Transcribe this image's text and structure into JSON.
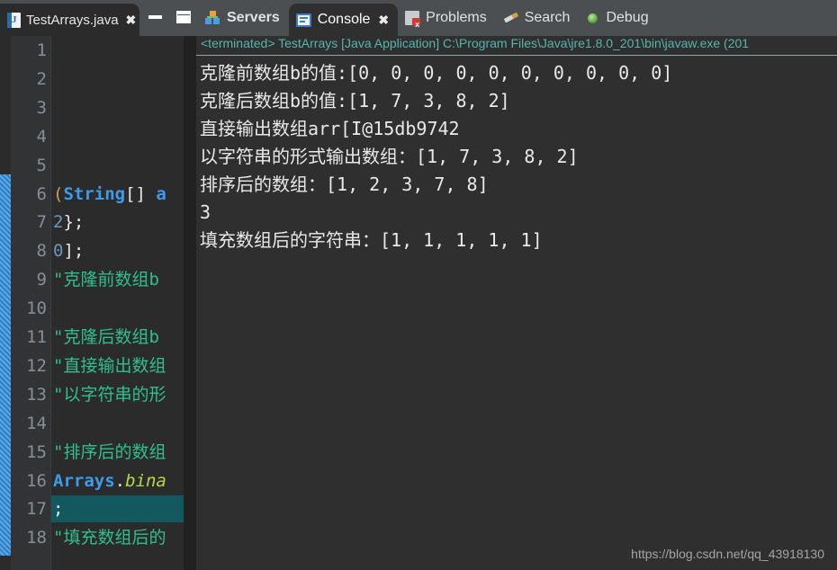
{
  "editor": {
    "tab": {
      "icon": "java-file-icon",
      "label": "TestArrays.java",
      "close": "✖"
    },
    "window_controls": {
      "minimize": "minimize",
      "maximize": "maximize"
    },
    "line_numbers": [
      "1",
      "2",
      "3",
      "4",
      "5",
      "6",
      "7",
      "8",
      "9",
      "10",
      "11",
      "12",
      "13",
      "14",
      "15",
      "16",
      "17",
      "18"
    ],
    "highlighted_line": "17",
    "code_lines": [
      {
        "line": "1",
        "segments": []
      },
      {
        "line": "2",
        "segments": []
      },
      {
        "line": "3",
        "segments": []
      },
      {
        "line": "4",
        "segments": []
      },
      {
        "line": "5",
        "segments": []
      },
      {
        "line": "6",
        "segments": [
          {
            "text": "(",
            "type": "paren"
          },
          {
            "text": "String",
            "type": "type"
          },
          {
            "text": "[]",
            "type": "punct"
          },
          {
            "text": " a",
            "type": "type"
          }
        ]
      },
      {
        "line": "7",
        "segments": [
          {
            "text": "2",
            "type": "num"
          },
          {
            "text": "};",
            "type": "punct"
          }
        ]
      },
      {
        "line": "8",
        "segments": [
          {
            "text": "0",
            "type": "num"
          },
          {
            "text": "];",
            "type": "punct"
          }
        ]
      },
      {
        "line": "9",
        "segments": [
          {
            "text": "\"克隆前数组b",
            "type": "str"
          }
        ]
      },
      {
        "line": "10",
        "segments": []
      },
      {
        "line": "11",
        "segments": [
          {
            "text": "\"克隆后数组b",
            "type": "str"
          }
        ]
      },
      {
        "line": "12",
        "segments": [
          {
            "text": "\"直接输出数组",
            "type": "str"
          }
        ]
      },
      {
        "line": "13",
        "segments": [
          {
            "text": "\"以字符串的形",
            "type": "str"
          }
        ]
      },
      {
        "line": "14",
        "segments": []
      },
      {
        "line": "15",
        "segments": [
          {
            "text": "\"排序后的数组",
            "type": "str"
          }
        ]
      },
      {
        "line": "16",
        "segments": [
          {
            "text": "Arrays",
            "type": "type"
          },
          {
            "text": ".",
            "type": "punct"
          },
          {
            "text": "bina",
            "type": "method"
          }
        ]
      },
      {
        "line": "17",
        "segments": [
          {
            "text": ";",
            "type": "plain"
          }
        ]
      },
      {
        "line": "18",
        "segments": [
          {
            "text": "\"填充数组后的",
            "type": "str"
          }
        ]
      }
    ]
  },
  "console": {
    "tabs": [
      {
        "label": "Servers",
        "icon": "servers-icon",
        "active": false,
        "closable": false,
        "bold": true
      },
      {
        "label": "Console",
        "icon": "console-icon",
        "active": true,
        "closable": true,
        "bold": false
      },
      {
        "label": "Problems",
        "icon": "problems-icon",
        "active": false,
        "closable": false,
        "bold": false
      },
      {
        "label": "Search",
        "icon": "search-icon",
        "active": false,
        "closable": false,
        "bold": false
      },
      {
        "label": "Debug",
        "icon": "debug-icon",
        "active": false,
        "closable": false,
        "bold": false
      }
    ],
    "close_glyph": "✖",
    "launch_info": "<terminated> TestArrays [Java Application] C:\\Program Files\\Java\\jre1.8.0_201\\bin\\javaw.exe (201",
    "output_lines": [
      "克隆前数组b的值:[0, 0, 0, 0, 0, 0, 0, 0, 0, 0]",
      "克隆后数组b的值:[1, 7, 3, 8, 2]",
      "直接输出数组arr[I@15db9742",
      "以字符串的形式输出数组：[1, 7, 3, 8, 2]",
      "排序后的数组：[1, 2, 3, 7, 8]",
      "3",
      "填充数组后的字符串：[1, 1, 1, 1, 1]"
    ]
  },
  "watermark": "https://blog.csdn.net/qq_43918130",
  "colors": {
    "tabbar_bg": "#4b4f52",
    "editor_bg": "#2b2b2b",
    "console_bg": "#2f2f2f",
    "gutter_bg": "#313335",
    "line_number": "#868f96",
    "string_token": "#2fbf8f",
    "type_token": "#3d9be9",
    "method_token": "#b5d94b",
    "number_token": "#6897bb",
    "terminated_text": "#55b5b0",
    "current_line_highlight": "#13575f",
    "change_bar": "#3b8ed0"
  }
}
